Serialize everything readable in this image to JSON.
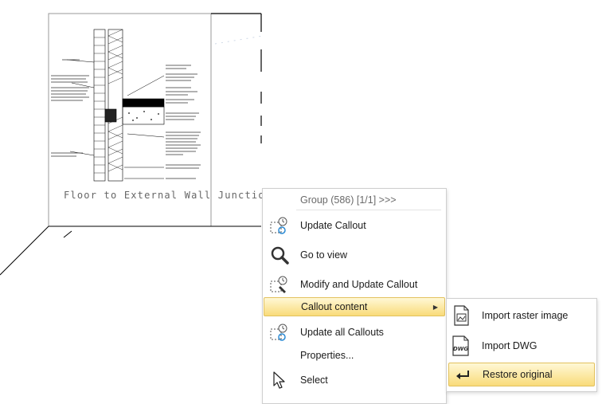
{
  "drawing": {
    "title": "Floor to External Wall Junction"
  },
  "context_menu": {
    "header": "Group (586) [1/1] >>>",
    "items": [
      {
        "label": "Update Callout",
        "icon": "callout-refresh-icon"
      },
      {
        "label": "Go to view",
        "icon": "magnifier-icon"
      },
      {
        "label": "Modify and Update Callout",
        "icon": "callout-modify-icon"
      },
      {
        "label": "Callout content",
        "icon": "",
        "has_submenu": true,
        "highlighted": true
      },
      {
        "label": "Update all Callouts",
        "icon": "callout-refresh-all-icon"
      },
      {
        "label": "Properties...",
        "icon": ""
      },
      {
        "label": "Select",
        "icon": "cursor-arrow-icon"
      }
    ]
  },
  "submenu": {
    "items": [
      {
        "label": "Import raster image",
        "icon": "raster-image-file-icon"
      },
      {
        "label": "Import DWG",
        "icon": "dwg-file-icon"
      },
      {
        "label": "Restore original",
        "icon": "restore-arrow-icon",
        "highlighted": true
      }
    ]
  },
  "colors": {
    "highlight_top": "#fff8d6",
    "highlight_bottom": "#f9db7a",
    "highlight_border": "#e2c15d"
  }
}
